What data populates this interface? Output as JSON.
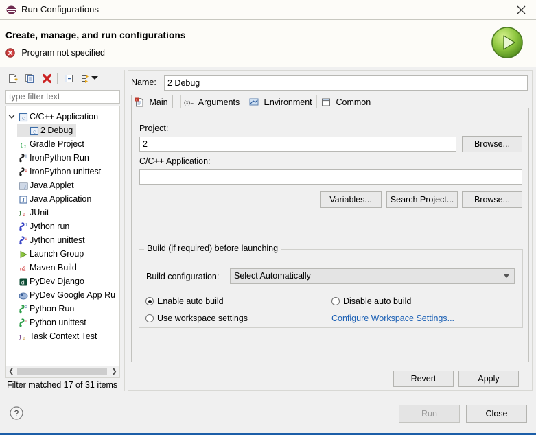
{
  "window": {
    "title": "Run Configurations",
    "title_icon": "eclipse-run-icon",
    "close_icon": "close-icon"
  },
  "header": {
    "title": "Create, manage, and run configurations",
    "status_text": "Program not specified",
    "status_icon": "error-icon",
    "run_icon": "green-run-play-icon",
    "error_color": "#c0392b"
  },
  "sidebar": {
    "toolbar": [
      {
        "name": "new-configuration-button",
        "icon": "new-document-icon"
      },
      {
        "name": "duplicate-configuration-button",
        "icon": "copy-icon"
      },
      {
        "name": "delete-configuration-button",
        "icon": "red-x-delete-icon"
      },
      {
        "name": "collapse-all-button",
        "icon": "collapse-all-icon"
      },
      {
        "name": "filter-button",
        "icon": "filter-arrows-icon"
      },
      {
        "name": "view-menu-button",
        "icon": "chevron-down-icon"
      }
    ],
    "filter": {
      "placeholder": "type filter text",
      "value": ""
    },
    "tree": [
      {
        "label": "C/C++ Application",
        "icon": "c-app-icon",
        "depth": 0,
        "expanded": true,
        "selected": false
      },
      {
        "label": "2 Debug",
        "icon": "c-app-icon",
        "depth": 1,
        "expanded": null,
        "selected": true
      },
      {
        "label": "Gradle Project",
        "icon": "gradle-icon",
        "depth": 0,
        "expanded": null,
        "selected": false
      },
      {
        "label": "IronPython Run",
        "icon": "ironpython-run-icon",
        "depth": 0,
        "expanded": null,
        "selected": false
      },
      {
        "label": "IronPython unittest",
        "icon": "ironpython-unittest-icon",
        "depth": 0,
        "expanded": null,
        "selected": false
      },
      {
        "label": "Java Applet",
        "icon": "java-applet-icon",
        "depth": 0,
        "expanded": null,
        "selected": false
      },
      {
        "label": "Java Application",
        "icon": "java-application-icon",
        "depth": 0,
        "expanded": null,
        "selected": false
      },
      {
        "label": "JUnit",
        "icon": "junit-icon",
        "depth": 0,
        "expanded": null,
        "selected": false
      },
      {
        "label": "Jython run",
        "icon": "jython-run-icon",
        "depth": 0,
        "expanded": null,
        "selected": false
      },
      {
        "label": "Jython unittest",
        "icon": "jython-unittest-icon",
        "depth": 0,
        "expanded": null,
        "selected": false
      },
      {
        "label": "Launch Group",
        "icon": "launch-group-icon",
        "depth": 0,
        "expanded": null,
        "selected": false
      },
      {
        "label": "Maven Build",
        "icon": "maven-icon",
        "depth": 0,
        "expanded": null,
        "selected": false
      },
      {
        "label": "PyDev Django",
        "icon": "django-icon",
        "depth": 0,
        "expanded": null,
        "selected": false
      },
      {
        "label": "PyDev Google App Ru",
        "icon": "google-app-engine-icon",
        "depth": 0,
        "expanded": null,
        "selected": false
      },
      {
        "label": "Python Run",
        "icon": "python-run-icon",
        "depth": 0,
        "expanded": null,
        "selected": false
      },
      {
        "label": "Python unittest",
        "icon": "python-unittest-icon",
        "depth": 0,
        "expanded": null,
        "selected": false
      },
      {
        "label": "Task Context Test",
        "icon": "task-context-test-icon",
        "depth": 0,
        "expanded": null,
        "selected": false
      }
    ],
    "scroll_left_icon": "scroll-left-icon",
    "scroll_right_icon": "scroll-right-icon",
    "status": "Filter matched 17 of 31 items"
  },
  "main": {
    "name_label": "Name:",
    "name_value": "2 Debug",
    "name_placeholder": "",
    "tabs": [
      {
        "label": "Main",
        "icon": "main-tab-icon",
        "active": true
      },
      {
        "label": "Arguments",
        "icon": "arguments-tab-icon",
        "active": false
      },
      {
        "label": "Environment",
        "icon": "environment-tab-icon",
        "active": false
      },
      {
        "label": "Common",
        "icon": "common-tab-icon",
        "active": false
      }
    ],
    "project": {
      "label": "Project:",
      "value": "2",
      "placeholder": "",
      "browse_label": "Browse..."
    },
    "application": {
      "label": "C/C++ Application:",
      "value": "",
      "placeholder": "",
      "variables_label": "Variables...",
      "search_project_label": "Search Project...",
      "browse_label": "Browse..."
    },
    "build_group": {
      "title": "Build (if required) before launching",
      "build_configuration_label": "Build configuration:",
      "build_configuration_value": "Select Automatically",
      "dropdown_icon": "chevron-down-icon",
      "radios": [
        {
          "label": "Enable auto build",
          "checked": true
        },
        {
          "label": "Disable auto build",
          "checked": false
        },
        {
          "label": "Use workspace settings",
          "checked": false
        }
      ],
      "configure_link": "Configure Workspace Settings...",
      "link_color": "#1a5fb4"
    },
    "revert_label": "Revert",
    "apply_label": "Apply"
  },
  "footer": {
    "help_icon": "help-question-icon",
    "run_label": "Run",
    "run_disabled": true,
    "close_label": "Close"
  }
}
